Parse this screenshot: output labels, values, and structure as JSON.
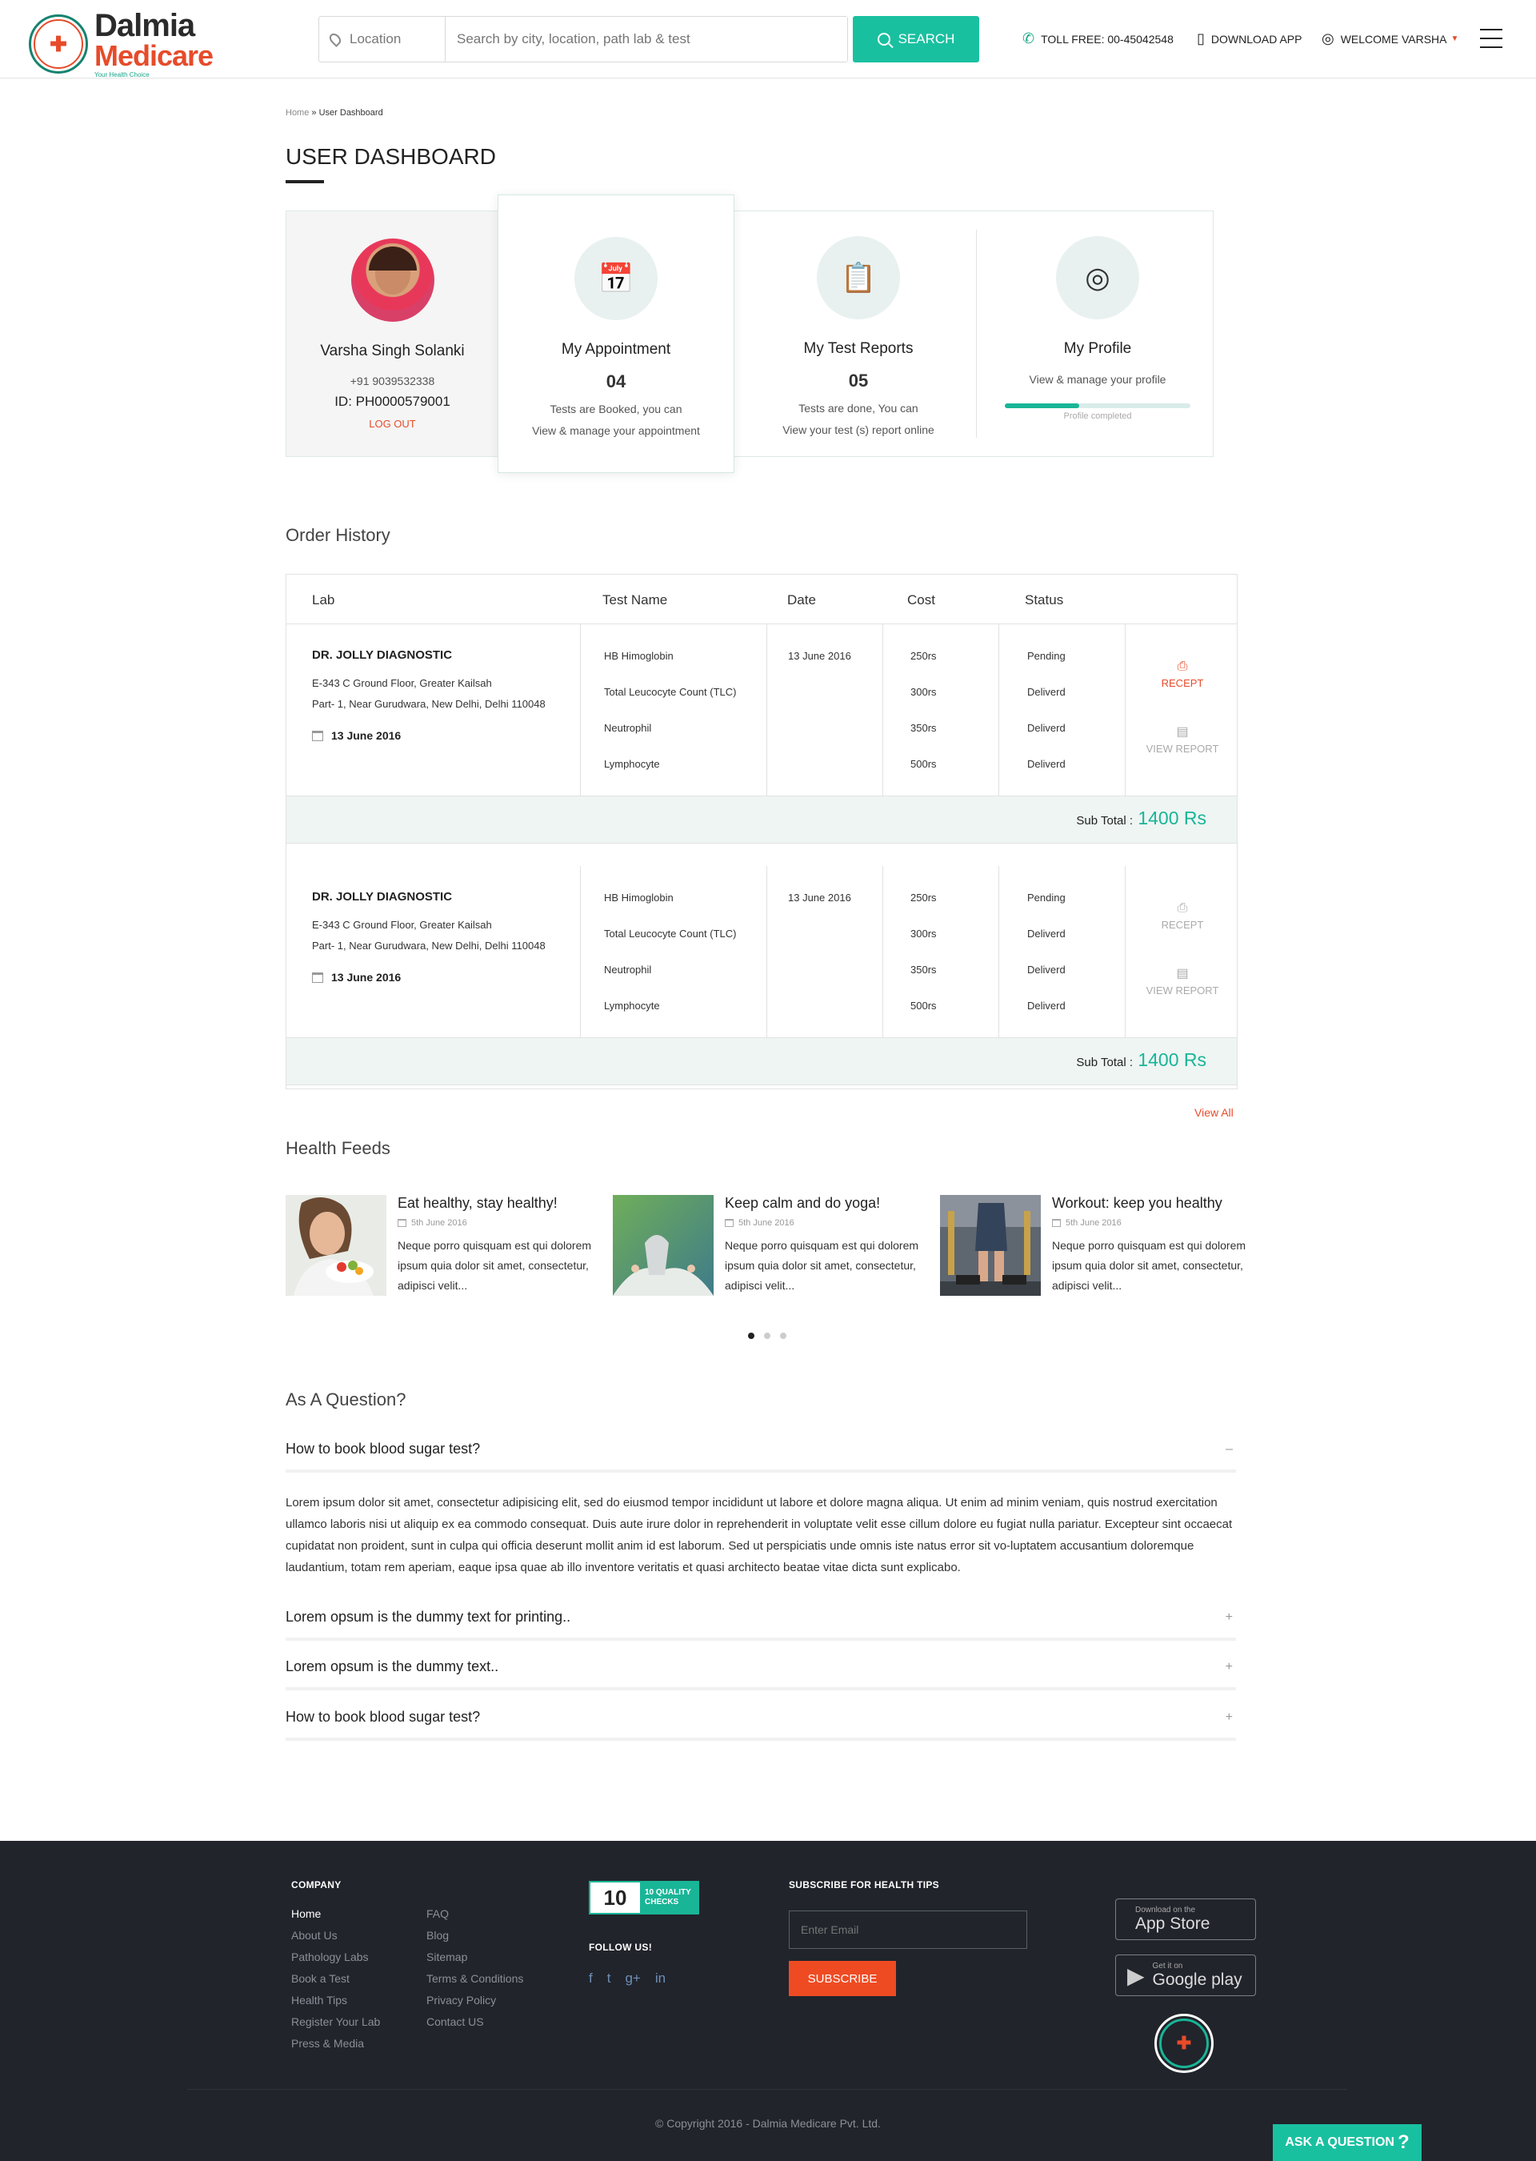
{
  "header": {
    "logo_line1": "Dalmia",
    "logo_line2": "Medicare",
    "logo_tagline": "Your Health Choice",
    "location_placeholder": "Location",
    "search_placeholder": "Search by city, location, path lab & test",
    "search_button": "SEARCH",
    "toll_free": "TOLL FREE: 00-45042548",
    "download_app": "DOWNLOAD APP",
    "welcome": "WELCOME VARSHA"
  },
  "breadcrumb": {
    "home": "Home",
    "sep": "»",
    "current": "User Dashboard"
  },
  "page_title": "USER DASHBOARD",
  "profile": {
    "name": "Varsha Singh Solanki",
    "phone": "+91 9039532338",
    "id": "ID: PH0000579001",
    "logout": "LOG OUT"
  },
  "cards": [
    {
      "title": "My Appointment",
      "count": "04",
      "desc1": "Tests are Booked, you can",
      "desc2": "View & manage your appointment"
    },
    {
      "title": "My Test Reports",
      "count": "05",
      "desc1": "Tests are done, You can",
      "desc2": "View your test (s) report online"
    },
    {
      "title": "My Profile",
      "desc1": "View & manage your profile",
      "progress_fraction": 0.4,
      "progress_label": "Profile completed"
    }
  ],
  "order_history": {
    "title": "Order History",
    "columns": [
      "Lab",
      "Test Name",
      "Date",
      "Cost",
      "Status"
    ],
    "orders": [
      {
        "lab": "DR. JOLLY DIAGNOSTIC",
        "addr1": "E-343 C Ground Floor, Greater Kailsah",
        "addr2": "Part- 1, Near Gurudwara, New Delhi, Delhi 110048",
        "lab_date": "13 June 2016",
        "date": "13 June 2016",
        "tests": [
          "HB Himoglobin",
          "Total Leucocyte Count (TLC)",
          "Neutrophil",
          "Lymphocyte"
        ],
        "costs": [
          "250rs",
          "300rs",
          "350rs",
          "500rs"
        ],
        "statuses": [
          "Pending",
          "Deliverd",
          "Deliverd",
          "Deliverd"
        ],
        "receipt": "RECEPT",
        "report": "VIEW REPORT",
        "subtotal_label": "Sub Total :",
        "subtotal": "1400 Rs"
      },
      {
        "lab": "DR. JOLLY DIAGNOSTIC",
        "addr1": "E-343 C Ground Floor, Greater Kailsah",
        "addr2": "Part- 1, Near Gurudwara, New Delhi, Delhi 110048",
        "lab_date": "13 June 2016",
        "date": "13 June 2016",
        "tests": [
          "HB Himoglobin",
          "Total Leucocyte Count (TLC)",
          "Neutrophil",
          "Lymphocyte"
        ],
        "costs": [
          "250rs",
          "300rs",
          "350rs",
          "500rs"
        ],
        "statuses": [
          "Pending",
          "Deliverd",
          "Deliverd",
          "Deliverd"
        ],
        "receipt": "RECEPT",
        "report": "VIEW REPORT",
        "subtotal_label": "Sub Total :",
        "subtotal": "1400 Rs"
      }
    ],
    "view_all": "View All"
  },
  "health_feeds": {
    "title": "Health Feeds",
    "items": [
      {
        "title": "Eat healthy, stay healthy!",
        "date": "5th June 2016",
        "text": "Neque porro quisquam est qui dolorem ipsum quia dolor sit amet, consectetur, adipisci velit..."
      },
      {
        "title": "Keep calm and do yoga!",
        "date": "5th June 2016",
        "text": "Neque porro quisquam est qui dolorem ipsum quia dolor sit amet, consectetur, adipisci velit..."
      },
      {
        "title": "Workout: keep you healthy",
        "date": "5th June 2016",
        "text": "Neque porro quisquam est qui dolorem ipsum quia dolor sit amet, consectetur, adipisci velit..."
      }
    ]
  },
  "faq": {
    "title": "As A Question?",
    "items": [
      {
        "q": "How to book blood sugar test?",
        "toggle": "–"
      },
      {
        "q": "Lorem opsum is the dummy text for printing..",
        "toggle": "+"
      },
      {
        "q": "Lorem opsum is the dummy text..",
        "toggle": "+"
      },
      {
        "q": "How to book blood sugar test?",
        "toggle": "+"
      }
    ],
    "answer": "Lorem ipsum dolor sit amet, consectetur adipisicing elit, sed do eiusmod tempor incididunt ut labore et dolore magna aliqua. Ut enim ad minim veniam, quis nostrud exercitation ullamco laboris nisi ut aliquip ex ea commodo consequat. Duis aute irure dolor in reprehenderit in voluptate velit esse cillum dolore eu fugiat nulla pariatur. Excepteur sint occaecat cupidatat non proident, sunt in culpa qui officia deserunt mollit anim id est laborum. Sed ut perspiciatis unde omnis iste natus error sit vo-luptatem accusantium doloremque laudantium, totam rem aperiam, eaque ipsa quae ab illo inventore veritatis et quasi architecto beatae vitae dicta sunt explicabo."
  },
  "footer": {
    "company_heading": "COMPANY",
    "links_col1": [
      "Home",
      "About Us",
      "Pathology Labs",
      "Book a Test",
      "Health Tips",
      "Register Your Lab",
      "Press & Media"
    ],
    "links_col2": [
      "FAQ",
      "Blog",
      "Sitemap",
      "Terms & Conditions",
      "Privacy Policy",
      "Contact US"
    ],
    "badge_num": "10",
    "badge_line1": "10 QUALITY",
    "badge_line2": "CHECKS",
    "follow": "FOLLOW US!",
    "subscribe_heading": "SUBSCRIBE FOR HEALTH TIPS",
    "email_placeholder": "Enter Email",
    "subscribe_button": "SUBSCRIBE",
    "appstore_small": "Download on the",
    "appstore_big": "App Store",
    "gplay_small": "Get it on",
    "gplay_big": "Google play",
    "copyright": "© Copyright 2016 - Dalmia Medicare Pvt. Ltd.",
    "ask_button": "ASK A QUESTION"
  },
  "colors": {
    "accent": "#19c0a0",
    "brand_red": "#e74b2a",
    "footer_bg": "#21242b"
  }
}
